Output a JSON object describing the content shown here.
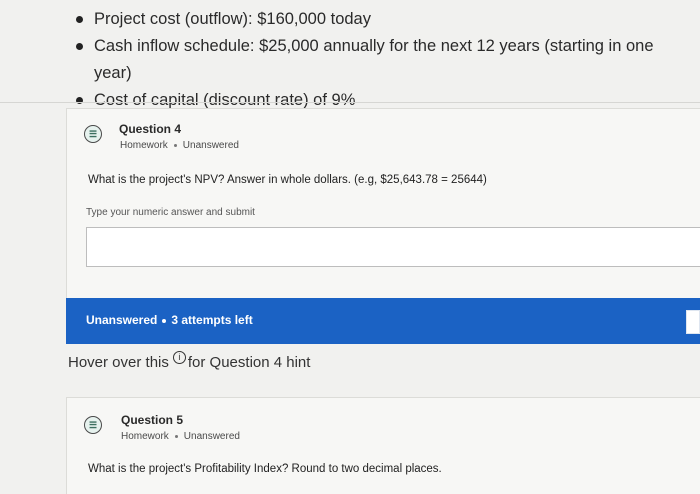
{
  "bullets": [
    "Project cost (outflow): $160,000 today",
    "Cash inflow schedule: $25,000 annually for the next 12 years (starting in one year)",
    "Cost of capital (discount rate) of 9%"
  ],
  "question4": {
    "title": "Question 4",
    "type": "Homework",
    "status": "Unanswered",
    "text": "What is the project's NPV? Answer in whole dollars. (e.g, $25,643.78 = 25644)",
    "placeholder": "Type your numeric answer and submit",
    "answer_value": ""
  },
  "status_bar": {
    "status": "Unanswered",
    "attempts": "3 attempts left"
  },
  "hint": {
    "before": "Hover over this",
    "icon_glyph": "i",
    "after": "for Question 4 hint"
  },
  "question5": {
    "title": "Question 5",
    "type": "Homework",
    "status": "Unanswered",
    "text": "What is the project's Profitability Index? Round to two decimal places."
  },
  "icons": {
    "question_icon": "list-icon",
    "hint_icon": "info-icon"
  },
  "colors": {
    "accent_blue": "#1b62c4",
    "background": "#f1f1ef",
    "card": "#f7f7f5"
  }
}
